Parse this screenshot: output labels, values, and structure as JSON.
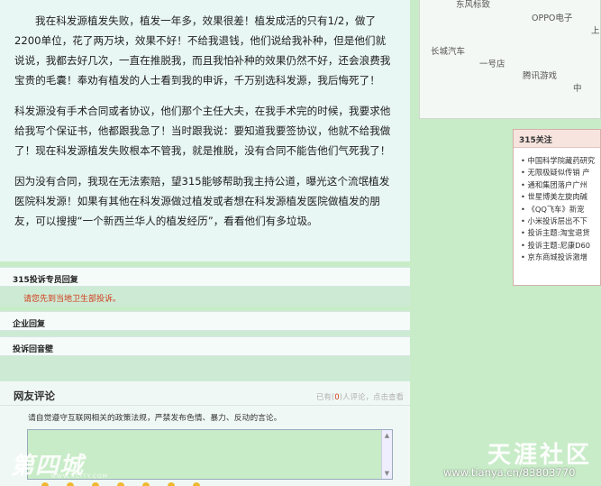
{
  "article": {
    "paragraphs": [
      "我在科发源植发失败，植发一年多，效果很差！植发成活的只有1/2，做了2200单位，花了两万块，效果不好！不给我退钱，他们说给我补种，但是他们就说说，我都去好几次，一直在推脱我，而且我怕补种的效果仍然不好，还会浪费我宝贵的毛囊！奉劝有植发的人士看到我的申诉，千万别选科发源，我后悔死了！",
      "科发源没有手术合同或者协议，他们那个主任大夫，在我手术完的时候，我要求他给我写个保证书，他都跟我急了！当时跟我说：要知道我要签协议，他就不给我做了！现在科发源植发失败根本不管我，就是推脱，没有合同不能告他们气死我了！",
      "因为没有合同，我现在无法索赔，望315能够帮助我主持公道，曝光这个流氓植发医院科发源！如果有其他在科发源做过植发或者想在科发源植发医院做植发的朋友，可以搜搜“一个新西兰华人的植发经历”，看看他们有多垃圾。"
    ]
  },
  "sections": {
    "expert_reply": {
      "title": "315投诉专员回复",
      "body": "请您先到当地卫生部投诉。"
    },
    "company_reply": {
      "title": "企业回复"
    },
    "complaint_review": {
      "title": "投诉回音壁"
    }
  },
  "comments": {
    "title": "网友评论",
    "meta_prefix": "已有(",
    "meta_count": "0",
    "meta_suffix": ")人评论，点击查看",
    "notice": "请自觉遵守互联网相关的政策法规，严禁发布色情、暴力、反动的言论。"
  },
  "map": {
    "labels": [
      "东风标致",
      "OPPO电子",
      "上",
      "长城汽车",
      "一号店",
      "腾讯游戏",
      "中"
    ]
  },
  "focus": {
    "title": "315关注",
    "items": [
      "中国科学院藏药研究",
      "无限极疑似传销 产",
      "通和集团落户广州",
      "世星博美左旋肉碱",
      "《QQ飞车》新宠",
      "小米投诉层出不下",
      "投诉主题:淘宝退货",
      "投诉主题:尼康D60",
      "京东商城投诉激增"
    ]
  },
  "watermarks": {
    "left_logo": "第四城",
    "left_sub": "WWW.4CITY.COM",
    "right_logo": "天涯社区",
    "right_url": "www.tianya.cn/83803770"
  },
  "colors": {
    "page_bg": "#c8ecc8",
    "accent_red": "#d13a1a",
    "focus_header": "#f7e4df"
  }
}
